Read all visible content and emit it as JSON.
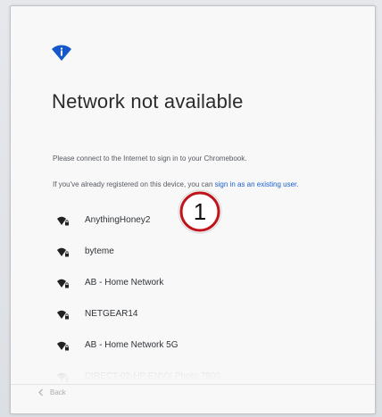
{
  "screen": {
    "title": "Network not available",
    "message_line1": "Please connect to the Internet to sign in to your Chromebook.",
    "message_line2_prefix": "If you've already registered on this device, you can ",
    "message_line2_link": "sign in as an existing user."
  },
  "networks": [
    {
      "name": "AnythingHoney2",
      "icon": "wifi-locked-icon"
    },
    {
      "name": "byteme",
      "icon": "wifi-locked-icon"
    },
    {
      "name": "AB - Home Network",
      "icon": "wifi-locked-icon"
    },
    {
      "name": "NETGEAR14",
      "icon": "wifi-locked-icon"
    },
    {
      "name": "AB - Home Network 5G",
      "icon": "wifi-locked-icon"
    },
    {
      "name": "DIRECT-02-HP ENVY Photo 7800",
      "icon": "wifi-locked-icon"
    }
  ],
  "footer": {
    "back_label": "Back"
  },
  "annotation": {
    "callout_number": "1"
  },
  "colors": {
    "accent": "#1a5fd0",
    "callout_ring": "#c0161b"
  }
}
